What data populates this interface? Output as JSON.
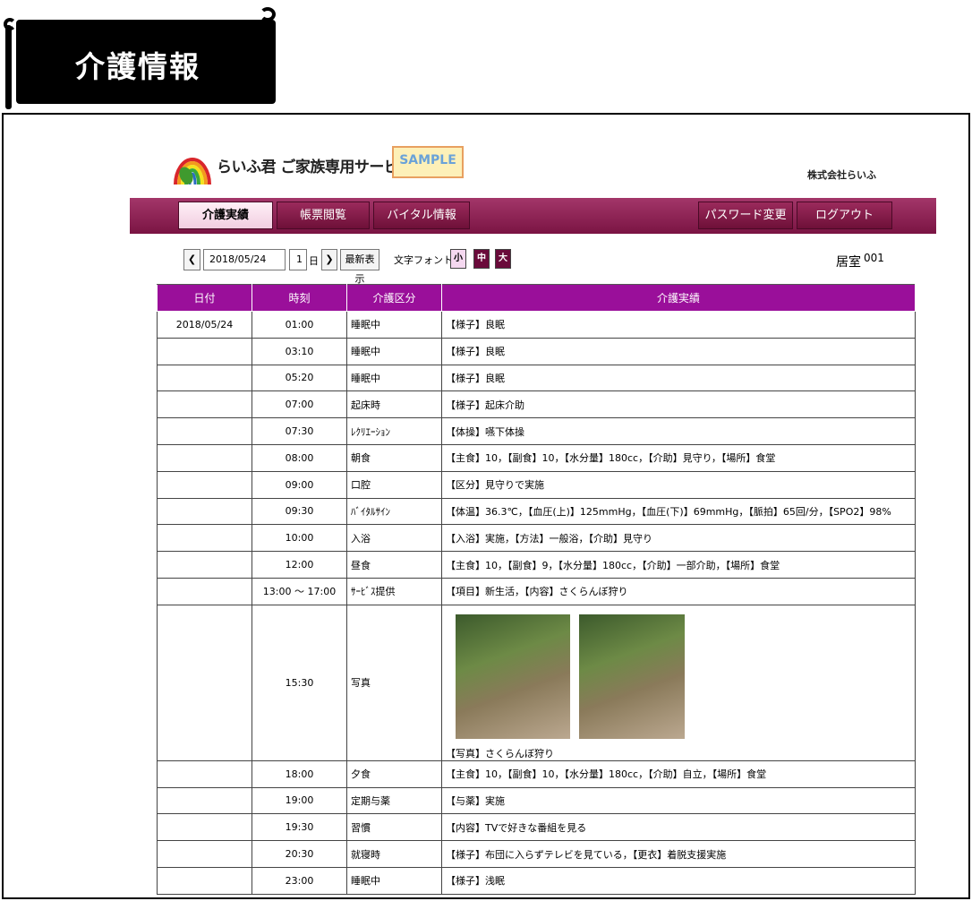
{
  "page": {
    "title": "介護情報"
  },
  "header": {
    "service_name": "らいふ君 ご家族専用サービス",
    "sample_badge": "SAMPLE",
    "company": "株式会社らいふ"
  },
  "nav": {
    "tabs": [
      {
        "label": "介護実績",
        "active": true
      },
      {
        "label": "帳票閲覧",
        "active": false
      },
      {
        "label": "バイタル情報",
        "active": false
      }
    ],
    "password_change": "パスワード変更",
    "logout": "ログアウト"
  },
  "toolbar": {
    "prev": "❮",
    "date": "2018/05/24",
    "days": "1",
    "days_unit": "日",
    "next": "❯",
    "refresh": "最新表示",
    "font_label": "文字フォント:",
    "font_small": "小",
    "font_medium": "中",
    "font_large": "大",
    "room_label": "居室",
    "room_value": "001"
  },
  "table": {
    "headers": [
      "日付",
      "時刻",
      "介護区分",
      "介護実績"
    ],
    "date": "2018/05/24",
    "rows": [
      {
        "time": "01:00",
        "category": "睡眠中",
        "record": "【様子】良眠"
      },
      {
        "time": "03:10",
        "category": "睡眠中",
        "record": "【様子】良眠"
      },
      {
        "time": "05:20",
        "category": "睡眠中",
        "record": "【様子】良眠"
      },
      {
        "time": "07:00",
        "category": "起床時",
        "record": "【様子】起床介助"
      },
      {
        "time": "07:30",
        "category": "ﾚｸﾘｴｰｼｮﾝ",
        "record": "【体操】嚥下体操"
      },
      {
        "time": "08:00",
        "category": "朝食",
        "record": "【主食】10，【副食】10，【水分量】180cc，【介助】見守り，【場所】食堂"
      },
      {
        "time": "09:00",
        "category": "口腔",
        "record": "【区分】見守りで実施"
      },
      {
        "time": "09:30",
        "category": "ﾊﾞｲﾀﾙｻｲﾝ",
        "record": "【体温】36.3℃，【血圧(上)】125mmHg，【血圧(下)】69mmHg，【脈拍】65回/分，【SPO2】98%"
      },
      {
        "time": "10:00",
        "category": "入浴",
        "record": "【入浴】実施，【方法】一般浴，【介助】見守り"
      },
      {
        "time": "12:00",
        "category": "昼食",
        "record": "【主食】10，【副食】9，【水分量】180cc，【介助】一部介助，【場所】食堂"
      },
      {
        "time": "13:00 ～ 17:00",
        "category": "ｻｰﾋﾞｽ提供",
        "record": "【項目】新生活，【内容】さくらんぼ狩り"
      },
      {
        "time": "15:30",
        "category": "写真",
        "record": "【写真】さくらんぼ狩り",
        "photos": 2
      },
      {
        "time": "18:00",
        "category": "夕食",
        "record": "【主食】10，【副食】10，【水分量】180cc，【介助】自立，【場所】食堂"
      },
      {
        "time": "19:00",
        "category": "定期与薬",
        "record": "【与薬】実施"
      },
      {
        "time": "19:30",
        "category": "習慣",
        "record": "【内容】TVで好きな番組を見る"
      },
      {
        "time": "20:30",
        "category": "就寝時",
        "record": "【様子】布団に入らずテレビを見ている，【更衣】着脱支援実施"
      },
      {
        "time": "23:00",
        "category": "睡眠中",
        "record": "【様子】浅眠"
      }
    ]
  },
  "colors": {
    "nav": "#8a1e52",
    "table_header": "#9a0f9a",
    "sample_badge_bg": "#fdf0b8"
  }
}
